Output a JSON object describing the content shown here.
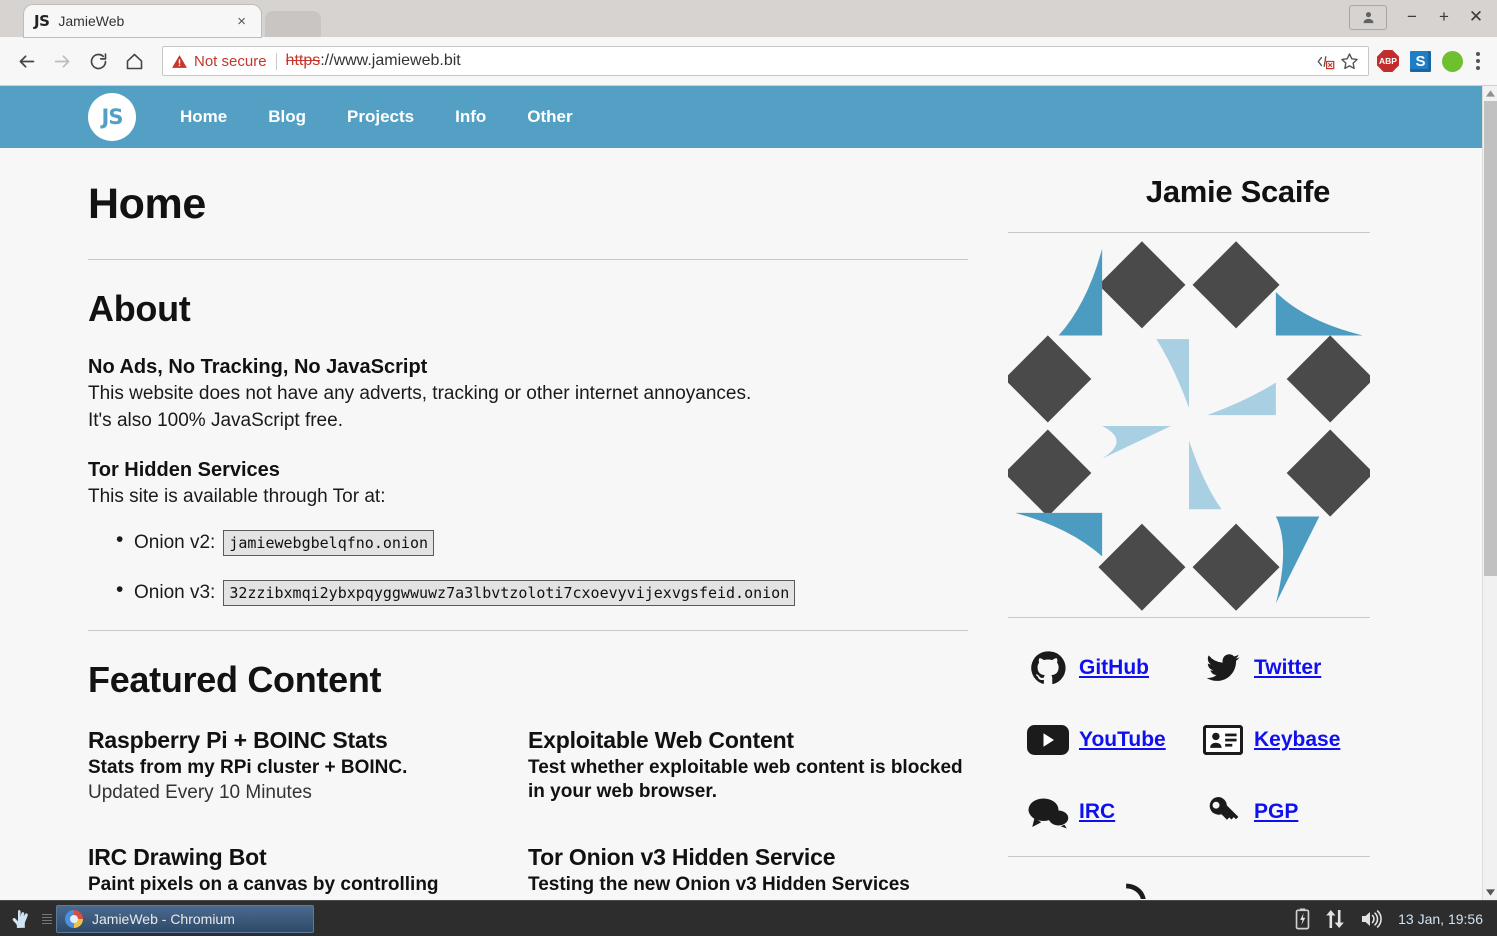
{
  "browser": {
    "tab": {
      "favicon_text": "JS",
      "title": "JamieWeb",
      "close_icon": "×"
    },
    "omnibox": {
      "security_label": "Not secure",
      "url_scheme": "https",
      "url_rest": "://www.jamieweb.bit"
    },
    "extensions": [
      {
        "name": "adblock-plus",
        "label": "ABP"
      },
      {
        "name": "skype",
        "label": "S"
      },
      {
        "name": "status-indicator",
        "label": ""
      }
    ],
    "window_controls": {
      "minimize": "−",
      "maximize": "+",
      "close": "✕"
    }
  },
  "site": {
    "nav": {
      "logo": "JS",
      "links": [
        {
          "label": "Home"
        },
        {
          "label": "Blog"
        },
        {
          "label": "Projects"
        },
        {
          "label": "Info"
        },
        {
          "label": "Other"
        }
      ]
    },
    "page_title": "Home",
    "about": {
      "heading": "About",
      "blocks": [
        {
          "title": "No Ads, No Tracking, No JavaScript",
          "line1": "This website does not have any adverts, tracking or other internet annoyances.",
          "line2": "It's also 100% JavaScript free."
        },
        {
          "title": "Tor Hidden Services",
          "line1": "This site is available through Tor at:"
        }
      ],
      "onions": [
        {
          "label": "Onion v2:",
          "address": "jamiewebgbelqfno.onion"
        },
        {
          "label": "Onion v3:",
          "address": "32zzibxmqi2ybxpqyggwwuwz7a3lbvtzoloti7cxoevyvijexvgsfeid.onion"
        }
      ]
    },
    "featured": {
      "heading": "Featured Content",
      "items": [
        {
          "title": "Raspberry Pi + BOINC Stats",
          "desc": "Stats from my RPi cluster + BOINC.",
          "meta": "Updated Every 10 Minutes"
        },
        {
          "title": "Exploitable Web Content",
          "desc": "Test whether exploitable web content is blocked in your web browser.",
          "meta": ""
        },
        {
          "title": "IRC Drawing Bot",
          "desc": "Paint pixels on a canvas by controlling",
          "meta": ""
        },
        {
          "title": "Tor Onion v3 Hidden Service",
          "desc": "Testing the new Onion v3 Hidden Services",
          "meta": ""
        }
      ]
    },
    "sidebar": {
      "name": "Jamie Scaife",
      "social": [
        {
          "icon": "github-icon",
          "label": "GitHub"
        },
        {
          "icon": "twitter-icon",
          "label": "Twitter"
        },
        {
          "icon": "youtube-icon",
          "label": "YouTube"
        },
        {
          "icon": "keybase-icon",
          "label": "Keybase"
        },
        {
          "icon": "irc-icon",
          "label": "IRC"
        },
        {
          "icon": "pgp-key-icon",
          "label": "PGP"
        }
      ]
    },
    "colors": {
      "nav_blue": "#53a0c4",
      "logo_dark": "#4a4a4a",
      "logo_blue": "#4b9cc0",
      "logo_light_blue": "#a9cfe3",
      "link_blue": "#1010ee",
      "page_bg": "#f7f7f7"
    }
  },
  "taskbar": {
    "window_title": "JamieWeb - Chromium",
    "clock": "13 Jan, 19:56"
  }
}
